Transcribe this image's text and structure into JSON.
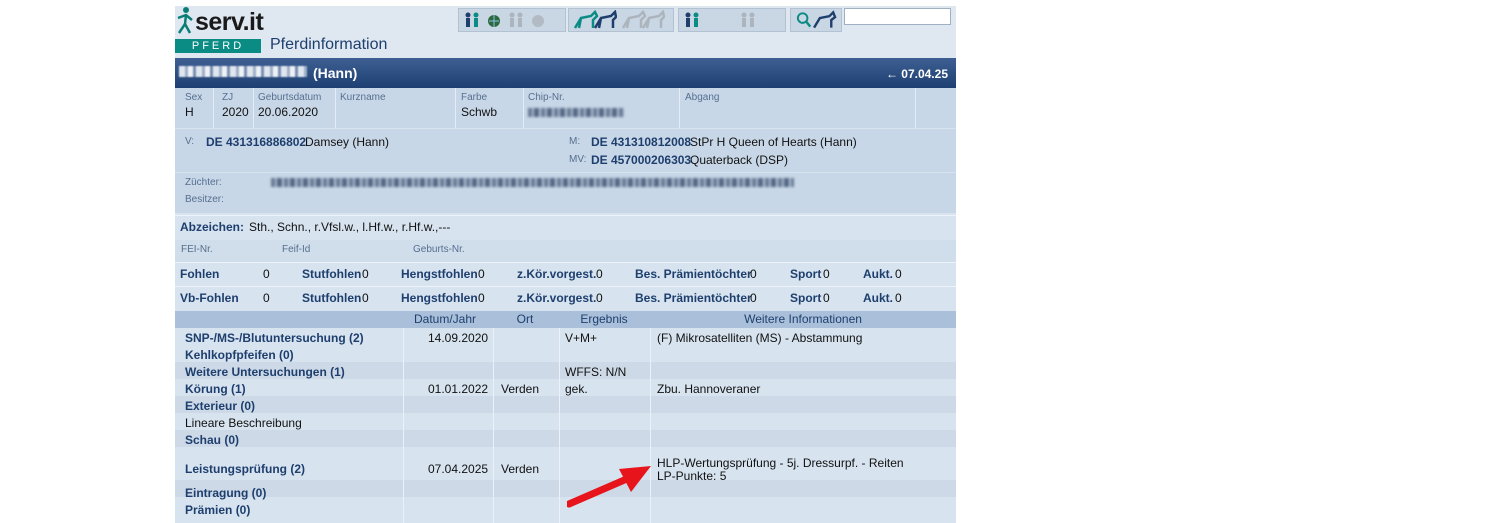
{
  "header": {
    "logo_text": "serv.it",
    "badge": "PFERD",
    "title": "Pferdinformation",
    "search_placeholder": "",
    "icons": [
      "family-icon",
      "globe-icon",
      "family-faded-icon",
      "globe-faded-icon",
      "horses-icon",
      "horses-faded-icon",
      "family-icon",
      "family-faded-icon",
      "search-horse-icon"
    ]
  },
  "titlebar": {
    "breed": "(Hann)",
    "date": "07.04.25"
  },
  "basic": {
    "labels": {
      "sex": "Sex",
      "zj": "ZJ",
      "birthdate": "Geburtsdatum",
      "shortname": "Kurzname",
      "color": "Farbe",
      "chip": "Chip-Nr.",
      "departure": "Abgang"
    },
    "values": {
      "sex": "H",
      "zj": "2020",
      "birthdate": "20.06.2020",
      "shortname": "",
      "color": "Schwb",
      "departure": ""
    }
  },
  "pedigree": {
    "v_label": "V:",
    "v_id": "DE 431316886802",
    "v_name": "Damsey (Hann)",
    "m_label": "M:",
    "m_id": "DE 431310812008",
    "m_name": "StPr H Queen of Hearts (Hann)",
    "mv_label": "MV:",
    "mv_id": "DE 457000206303",
    "mv_name": "Quaterback (DSP)"
  },
  "owners": {
    "breeder_label": "Züchter:",
    "owner_label": "Besitzer:"
  },
  "markings": {
    "label": "Abzeichen:",
    "value": "Sth., Schn., r.Vfsl.w., l.Hf.w., r.Hf.w.,---"
  },
  "ids": {
    "fei": "FEI-Nr.",
    "feif": "Feif-Id",
    "birthno": "Geburts-Nr."
  },
  "offspring": [
    {
      "label": "Fohlen",
      "count": "0",
      "stut_label": "Stutfohlen",
      "stut": "0",
      "hengst_label": "Hengstfohlen",
      "hengst": "0",
      "kor_label": "z.Kör.vorgest.",
      "kor": "0",
      "pt_label": "Bes. Prämientöchter",
      "pt": "0",
      "sport_label": "Sport",
      "sport": "0",
      "aukt_label": "Aukt.",
      "aukt": "0"
    },
    {
      "label": "Vb-Fohlen",
      "count": "0",
      "stut_label": "Stutfohlen",
      "stut": "0",
      "hengst_label": "Hengstfohlen",
      "hengst": "0",
      "kor_label": "z.Kör.vorgest.",
      "kor": "0",
      "pt_label": "Bes. Prämientöchter",
      "pt": "0",
      "sport_label": "Sport",
      "sport": "0",
      "aukt_label": "Aukt.",
      "aukt": "0"
    }
  ],
  "tests": {
    "headers": {
      "date": "Datum/Jahr",
      "place": "Ort",
      "result": "Ergebnis",
      "info": "Weitere Informationen"
    },
    "rows": [
      {
        "name": "SNP-/MS-/Blutuntersuchung (2)",
        "date": "14.09.2020",
        "place": "",
        "result": "V+M+",
        "info": "(F) Mikrosatelliten (MS) - Abstammung",
        "info2": ""
      },
      {
        "name": "Kehlkopfpfeifen (0)",
        "date": "",
        "place": "",
        "result": "",
        "info": "",
        "info2": ""
      },
      {
        "name": "Weitere Untersuchungen (1)",
        "date": "",
        "place": "",
        "result": "WFFS: N/N",
        "info": "",
        "info2": ""
      },
      {
        "name": "Körung (1)",
        "date": "01.01.2022",
        "place": "Verden",
        "result": "gek.",
        "info": "Zbu. Hannoveraner",
        "info2": ""
      },
      {
        "name": "Exterieur (0)",
        "date": "",
        "place": "",
        "result": "",
        "info": "",
        "info2": ""
      },
      {
        "name": "Lineare Beschreibung",
        "date": "",
        "place": "",
        "result": "",
        "info": "",
        "info2": ""
      },
      {
        "name": "Schau (0)",
        "date": "",
        "place": "",
        "result": "",
        "info": "",
        "info2": ""
      },
      {
        "name": "Leistungsprüfung (2)",
        "date": "07.04.2025",
        "place": "Verden",
        "result": "",
        "info": "HLP-Wertungsprüfung - 5j. Dressurpf. - Reiten",
        "info2": "LP-Punkte: 5"
      },
      {
        "name": "Eintragung (0)",
        "date": "",
        "place": "",
        "result": "",
        "info": "",
        "info2": ""
      },
      {
        "name": "Prämien (0)",
        "date": "",
        "place": "",
        "result": "",
        "info": "",
        "info2": ""
      }
    ]
  },
  "colors": {
    "accent": "#1e3f6e",
    "titlebar": "#2b4b80",
    "badge": "#0a8c84",
    "arrow": "#e8141b"
  }
}
